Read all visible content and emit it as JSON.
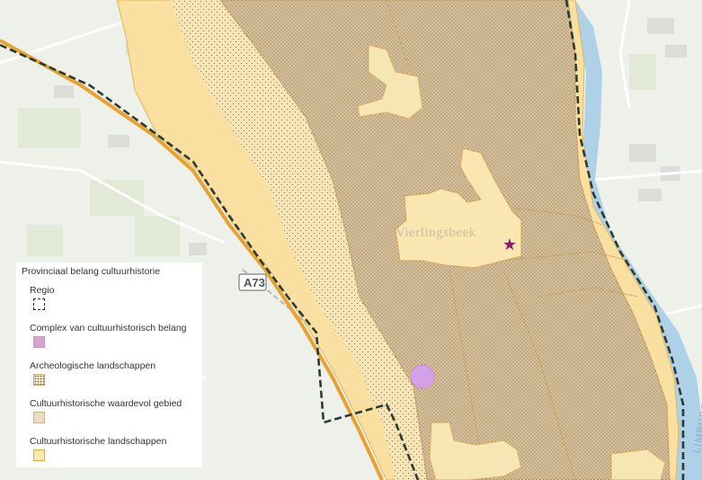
{
  "map": {
    "place_label": "Vierlingsbeek",
    "road_label": "A73",
    "province_label": "LIMBURG",
    "poi_marker": "star-icon",
    "colors": {
      "background": "#eef0ea",
      "river": "#aed1e8",
      "landschap_fill": "#f9dfa0",
      "landschap_edge": "#e7a831",
      "waardevol_fill": "#d8c19a",
      "archeo_dots": "#6b5a3a",
      "complex": "#d4a0e8",
      "star": "#8b1a6b",
      "regio_line": "#2b3b33"
    }
  },
  "legend": {
    "title": "Provinciaal belang cultuurhistorie",
    "items": [
      {
        "label": "Regio",
        "swatch": "dashed-outline"
      },
      {
        "label": "Complex van cultuurhistorisch belang",
        "swatch": "pink-fill"
      },
      {
        "label": "Archeologische landschappen",
        "swatch": "dotted-fill"
      },
      {
        "label": "Cultuurhistorische waardevol gebied",
        "swatch": "tan-fill"
      },
      {
        "label": "Cultuurhistorische landschappen",
        "swatch": "yellow-fill-orange-border"
      }
    ]
  }
}
